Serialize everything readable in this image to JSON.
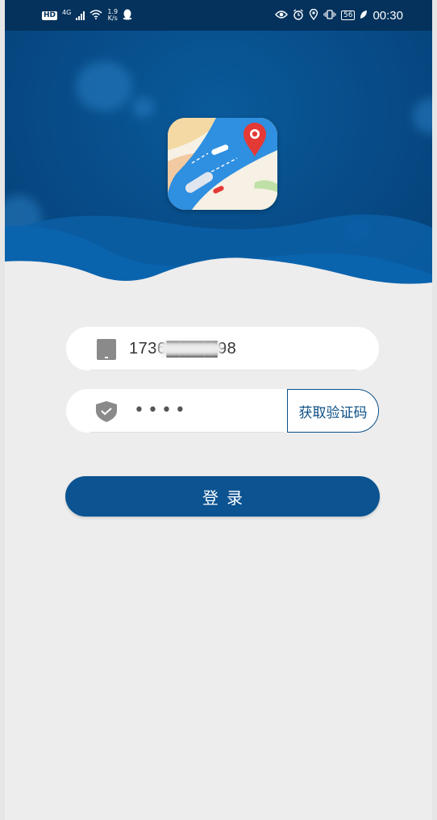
{
  "status_bar": {
    "hd": "HD",
    "network": "4G",
    "speed_value": "1.9",
    "speed_unit": "K/s",
    "battery": "56",
    "time": "00:30"
  },
  "login": {
    "phone_value": "1736▇▇▇▇98",
    "code_value": "••••",
    "get_code_label": "获取验证码",
    "login_label": "登录"
  },
  "colors": {
    "primary": "#0b5391",
    "header": "#074b87",
    "status_bar": "#04325c",
    "background": "#ededed"
  }
}
